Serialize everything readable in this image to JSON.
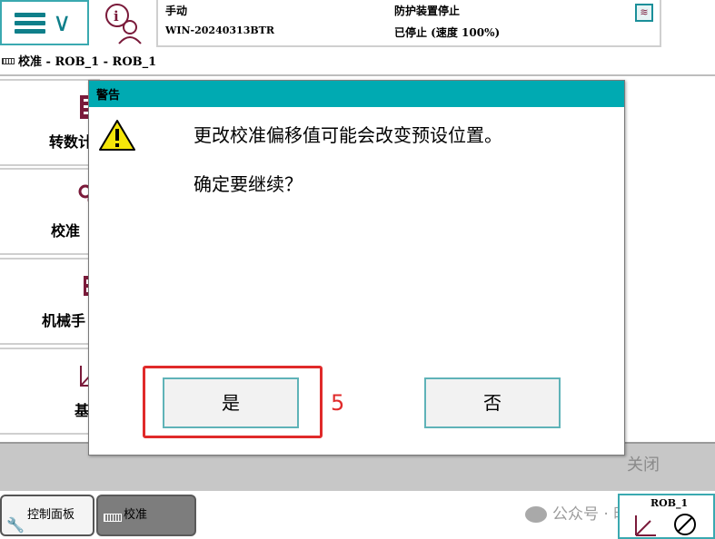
{
  "topbar": {
    "mode_label": "手动",
    "controller_name": "WIN-20240313BTR",
    "safety_state": "防护装置停止",
    "run_state": "已停止 (速度 100%)"
  },
  "breadcrumb": "校准 - ROB_1 - ROB_1",
  "left_tiles": [
    {
      "label": "转数计"
    },
    {
      "label": "校准"
    },
    {
      "label": "机械手"
    },
    {
      "label": "基"
    }
  ],
  "dialog": {
    "title": "警告",
    "message": "更改校准偏移值可能会改变预设位置。",
    "question": "确定要继续？",
    "yes_label": "是",
    "no_label": "否"
  },
  "bottom": {
    "close_label": "关闭"
  },
  "taskbar": {
    "control_panel_label": "控制面板",
    "calibration_label": "校准",
    "rob_label": "ROB_1",
    "watermark": "公众号 · 昭车楼"
  },
  "annotation": {
    "step": "5",
    "color": "#e02a2a"
  },
  "colors": {
    "accent": "#00aab2",
    "border_teal": "#3aa9b0",
    "warning": "#f5e60a"
  }
}
